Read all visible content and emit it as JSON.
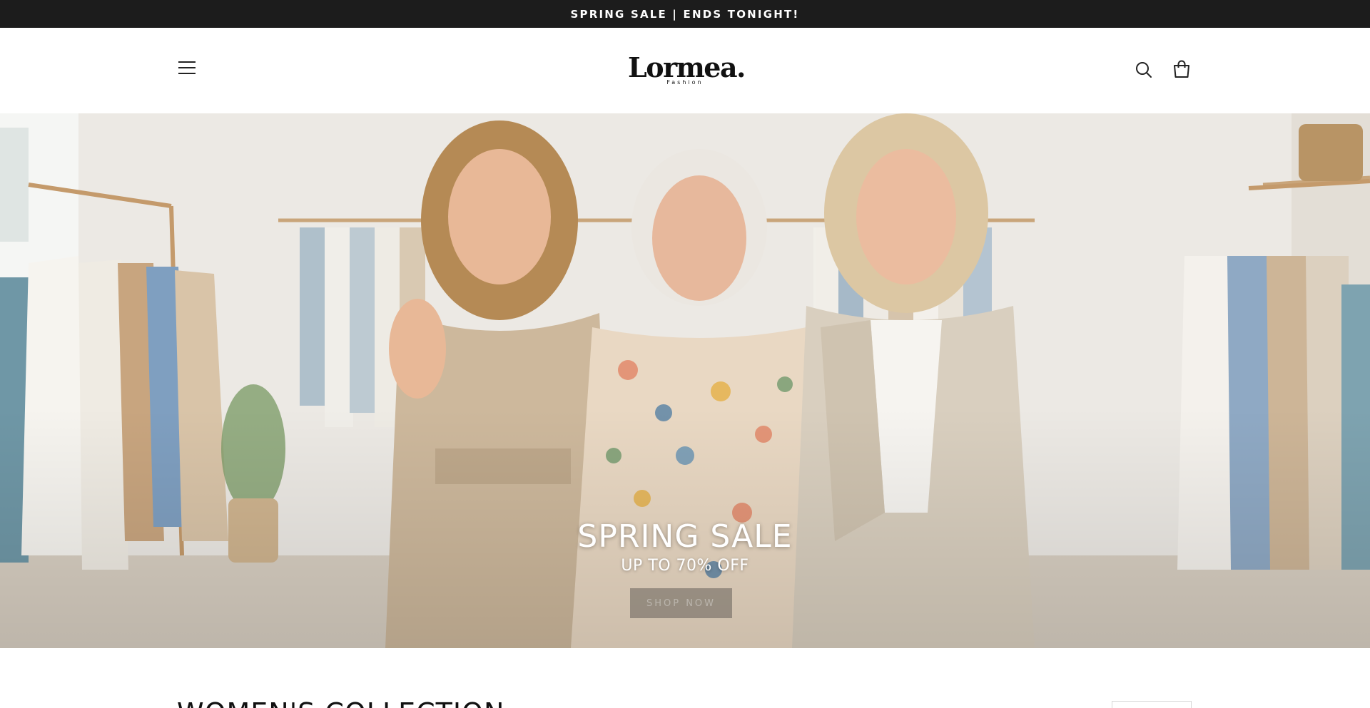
{
  "announcement": {
    "text": "SPRING SALE | ENDS TONIGHT!"
  },
  "header": {
    "logo_main": "Lormea.",
    "logo_sub": "Fashion",
    "icons": [
      "menu-icon",
      "search-icon",
      "cart-icon"
    ]
  },
  "hero": {
    "title": "SPRING SALE",
    "subtitle": "UP TO 70% OFF",
    "cta_label": "SHOP NOW"
  },
  "collection": {
    "title": "WOMEN'S COLLECTION"
  },
  "colors": {
    "announcement_bg": "#1c1c1c",
    "announcement_text": "#ffffff",
    "page_bg": "#ffffff",
    "hero_text": "#ffffff"
  }
}
